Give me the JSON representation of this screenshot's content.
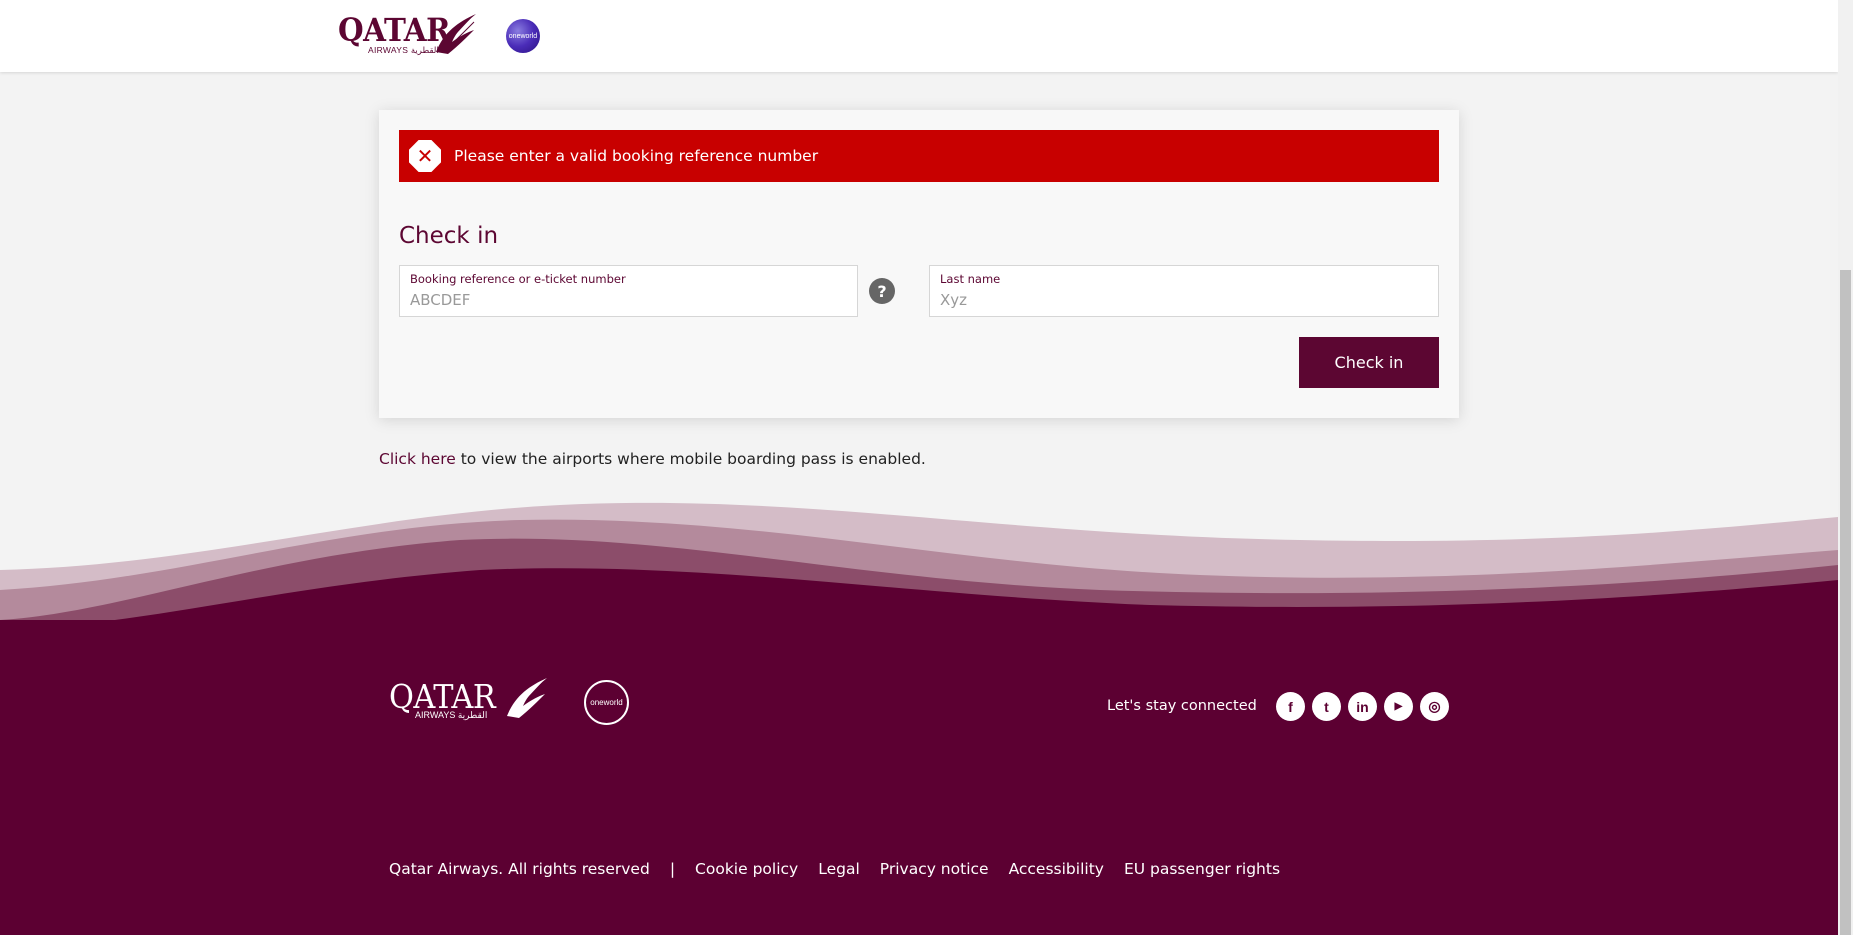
{
  "header": {
    "brand_name": "QATAR",
    "brand_sub": "AIRWAYS القطرية",
    "oneworld_label": "oneworld",
    "partial_text_left": "…",
    "partial_text_right": "…"
  },
  "error": {
    "icon": "close-icon",
    "message": "Please enter a valid booking reference number"
  },
  "checkin": {
    "title": "Check in",
    "booking_field": {
      "label": "Booking reference or e-ticket number",
      "placeholder": "ABCDEF",
      "value": ""
    },
    "help_icon": "?",
    "lastname_field": {
      "label": "Last name",
      "placeholder": "Xyz",
      "value": ""
    },
    "button_label": "Check in"
  },
  "mobile_note": {
    "link_text": "Click here",
    "text": " to view the airports where mobile boarding pass is enabled."
  },
  "footer": {
    "brand_name": "QATAR",
    "brand_sub": "AIRWAYS القطرية",
    "oneworld_label": "oneworld",
    "stay_connected": "Let's stay connected",
    "social": [
      {
        "name": "facebook-icon",
        "glyph": "f"
      },
      {
        "name": "twitter-icon",
        "glyph": "t"
      },
      {
        "name": "linkedin-icon",
        "glyph": "in"
      },
      {
        "name": "youtube-icon",
        "glyph": "▶"
      },
      {
        "name": "instagram-icon",
        "glyph": "◎"
      }
    ],
    "copyright": "Qatar Airways. All rights reserved",
    "separator": "|",
    "links": [
      "Cookie policy",
      "Legal",
      "Privacy notice",
      "Accessibility",
      "EU passenger rights"
    ]
  },
  "colors": {
    "brand": "#5c0632",
    "error": "#c80000",
    "footer_bg": "#5c0032"
  }
}
